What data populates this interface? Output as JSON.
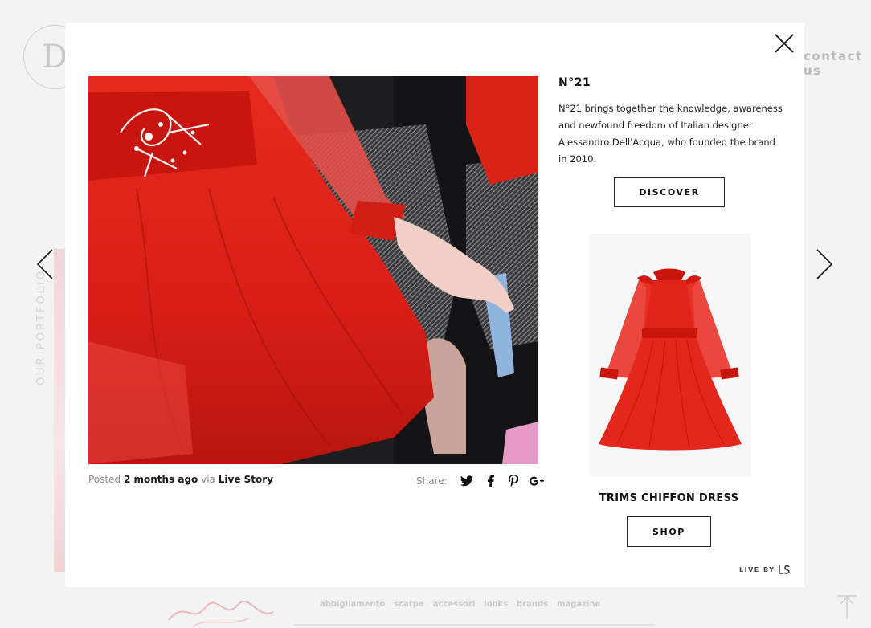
{
  "background": {
    "logo_letter": "D",
    "contact_label": "contact us",
    "portfolio_label": "OUR PORTFOLIO",
    "nav": [
      "abbigliamento",
      "scarpe",
      "accessori",
      "looks",
      "brands",
      "magazine"
    ]
  },
  "modal": {
    "brand": {
      "title": "N°21",
      "description": "N°21 brings together the knowledge, awareness and newfound freedom of Italian designer Alessandro Dell'Acqua, who founded the brand in 2010.",
      "discover_label": "DISCOVER"
    },
    "meta": {
      "posted_prefix": "Posted",
      "time_ago": "2 months ago",
      "via": "via",
      "source": "Live Story"
    },
    "share": {
      "label": "Share:",
      "networks": [
        "twitter-icon",
        "facebook-icon",
        "pinterest-icon",
        "google-plus-icon"
      ]
    },
    "product": {
      "name": "TRIMS CHIFFON DRESS",
      "shop_label": "SHOP"
    },
    "powered_by": "LIVE BY"
  },
  "colors": {
    "accent_red": "#e3261c",
    "modal_bg": "#ffffff",
    "page_bg": "#f3f3f4"
  }
}
